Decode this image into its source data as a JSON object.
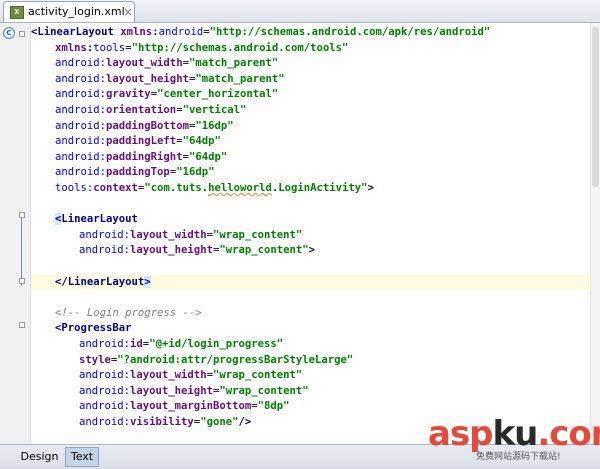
{
  "tab": {
    "title": "activity_login.xml",
    "icon": "xml-file-icon",
    "close": "×"
  },
  "editor": {
    "l1": {
      "a": "<LinearLayout",
      "b": " xmlns:",
      "c": "android",
      "d": "=",
      "e": "\"http://schemas.android.com/apk/res/android\""
    },
    "l2": {
      "a": "xmlns:",
      "b": "tools",
      "c": "=",
      "d": "\"http://schemas.android.com/tools\""
    },
    "l3": {
      "a": "android:",
      "b": "layout_width",
      "c": "=",
      "d": "\"match_parent\""
    },
    "l4": {
      "a": "android:",
      "b": "layout_height",
      "c": "=",
      "d": "\"match_parent\""
    },
    "l5": {
      "a": "android:",
      "b": "gravity",
      "c": "=",
      "d": "\"center_horizontal\""
    },
    "l6": {
      "a": "android:",
      "b": "orientation",
      "c": "=",
      "d": "\"vertical\""
    },
    "l7": {
      "a": "android:",
      "b": "paddingBottom",
      "c": "=",
      "d": "\"16dp\""
    },
    "l8": {
      "a": "android:",
      "b": "paddingLeft",
      "c": "=",
      "d": "\"64dp\""
    },
    "l9": {
      "a": "android:",
      "b": "paddingRight",
      "c": "=",
      "d": "\"64dp\""
    },
    "l10": {
      "a": "android:",
      "b": "paddingTop",
      "c": "=",
      "d": "\"16dp\""
    },
    "l11": {
      "a": "tools:",
      "b": "context",
      "c": "=",
      "d": "\"com.tuts.",
      "e": "helloworld",
      "f": ".LoginActivity\"",
      "g": ">"
    },
    "l13": {
      "a": "<",
      "b": "LinearLayout"
    },
    "l14": {
      "a": "android:",
      "b": "layout_width",
      "c": "=",
      "d": "\"wrap_content\""
    },
    "l15": {
      "a": "android:",
      "b": "layout_height",
      "c": "=",
      "d": "\"wrap_content\"",
      "e": ">"
    },
    "l17": {
      "a": "</LinearLayout",
      "b": ">"
    },
    "l19": {
      "a": "<!-- Login progress -->"
    },
    "l20": {
      "a": "<ProgressBar"
    },
    "l21": {
      "a": "android:",
      "b": "id",
      "c": "=",
      "d": "\"@+id/login_progress\""
    },
    "l22": {
      "a": "style",
      "b": "=",
      "c": "\"?android:attr/progressBarStyleLarge\""
    },
    "l23": {
      "a": "android:",
      "b": "layout_width",
      "c": "=",
      "d": "\"wrap_content\""
    },
    "l24": {
      "a": "android:",
      "b": "layout_height",
      "c": "=",
      "d": "\"wrap_content\""
    },
    "l25": {
      "a": "android:",
      "b": "layout_marginBottom",
      "c": "=",
      "d": "\"8dp\""
    },
    "l26": {
      "a": "android:",
      "b": "visibility",
      "c": "=",
      "d": "\"gone\"",
      "e": "/>"
    }
  },
  "bottom_tabs": {
    "design": "Design",
    "text": "Text"
  },
  "watermark": {
    "main_a": "asp",
    "main_k": "ku",
    "main_b": ".com",
    "sub": "免费网站源码下载站!"
  },
  "gutter_icons": {
    "class_marker": "C",
    "bulb": "lightbulb-icon"
  }
}
